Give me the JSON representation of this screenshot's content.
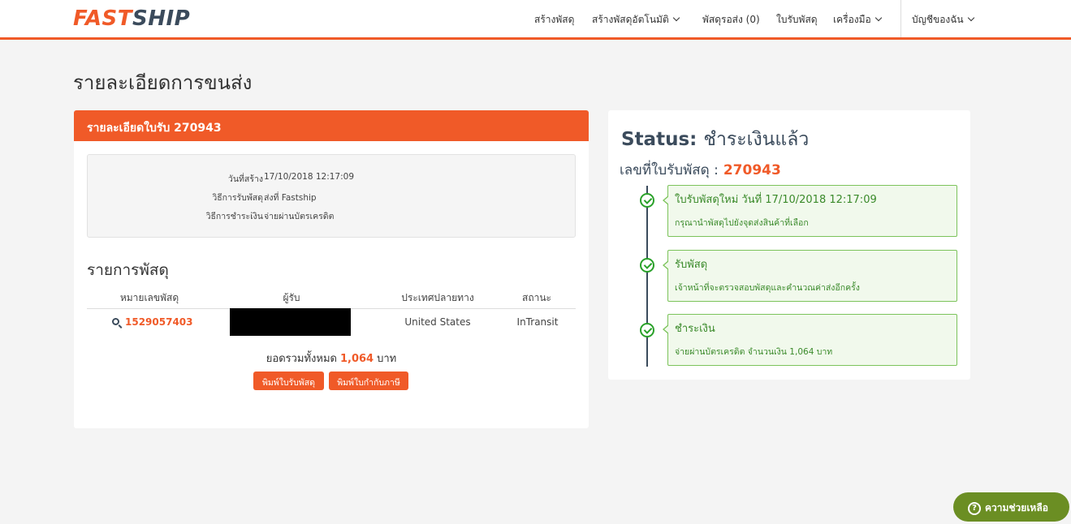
{
  "nav": {
    "logo_fast": "FAST",
    "logo_ship": "SHIP",
    "items": [
      "สร้างพัสดุ",
      "สร้างพัสดุอัตโนมัติ",
      "พัสดุรอส่ง (0)",
      "ใบรับพัสดุ",
      "เครื่องมือ",
      "บัญชีของฉัน"
    ]
  },
  "page_title": "รายละเอียดการขนส่ง",
  "receipt": {
    "header": "รายละเอียดใบรับ 270943",
    "info": [
      {
        "label": "วันที่สร้าง",
        "value": "17/10/2018 12:17:09"
      },
      {
        "label": "วิธีการรับพัสดุ",
        "value": "ส่งที่ Fastship"
      },
      {
        "label": "วิธีการชำระเงิน",
        "value": "จ่ายผ่านบัตรเครดิต"
      }
    ],
    "colon": ":",
    "parcels_title": "รายการพัสดุ",
    "columns": [
      "หมายเลขพัสดุ",
      "ผู้รับ",
      "ประเทศปลายทาง",
      "สถานะ"
    ],
    "rows": [
      {
        "tracking": "1529057403",
        "recipient": "",
        "country": "United States",
        "status": "InTransit"
      }
    ],
    "total_label": "ยอดรวมทั้งหมด",
    "total_amount": "1,064",
    "total_unit": "บาท",
    "btn_print_receipt": "พิมพ์ใบรับพัสดุ",
    "btn_print_invoice": "พิมพ์ใบกำกับภาษี"
  },
  "status": {
    "label": "Status:",
    "value": "ชำระเงินแล้ว",
    "receipt_label": "เลขที่ใบรับพัสดุ :",
    "receipt_number": "270943",
    "timeline": [
      {
        "title": "ใบรับพัสดุใหม่ วันที่ 17/10/2018 12:17:09",
        "desc": "กรุณานำพัสดุไปยังจุดส่งสินค้าที่เลือก"
      },
      {
        "title": "รับพัสดุ",
        "desc": "เจ้าหน้าที่จะตรวจสอบพัสดุและคำนวณค่าส่งอีกครั้ง"
      },
      {
        "title": "ชำระเงิน",
        "desc": "จ่ายผ่านบัตรเครดิต จำนวนเงิน 1,064 บาท"
      }
    ]
  },
  "help": {
    "icon": "?",
    "label": "ความช่วยเหลือ"
  },
  "colors": {
    "accent": "#f05a28",
    "dark": "#3b4b5c",
    "success": "#2aa12a",
    "help_bg": "#6b8e23"
  }
}
